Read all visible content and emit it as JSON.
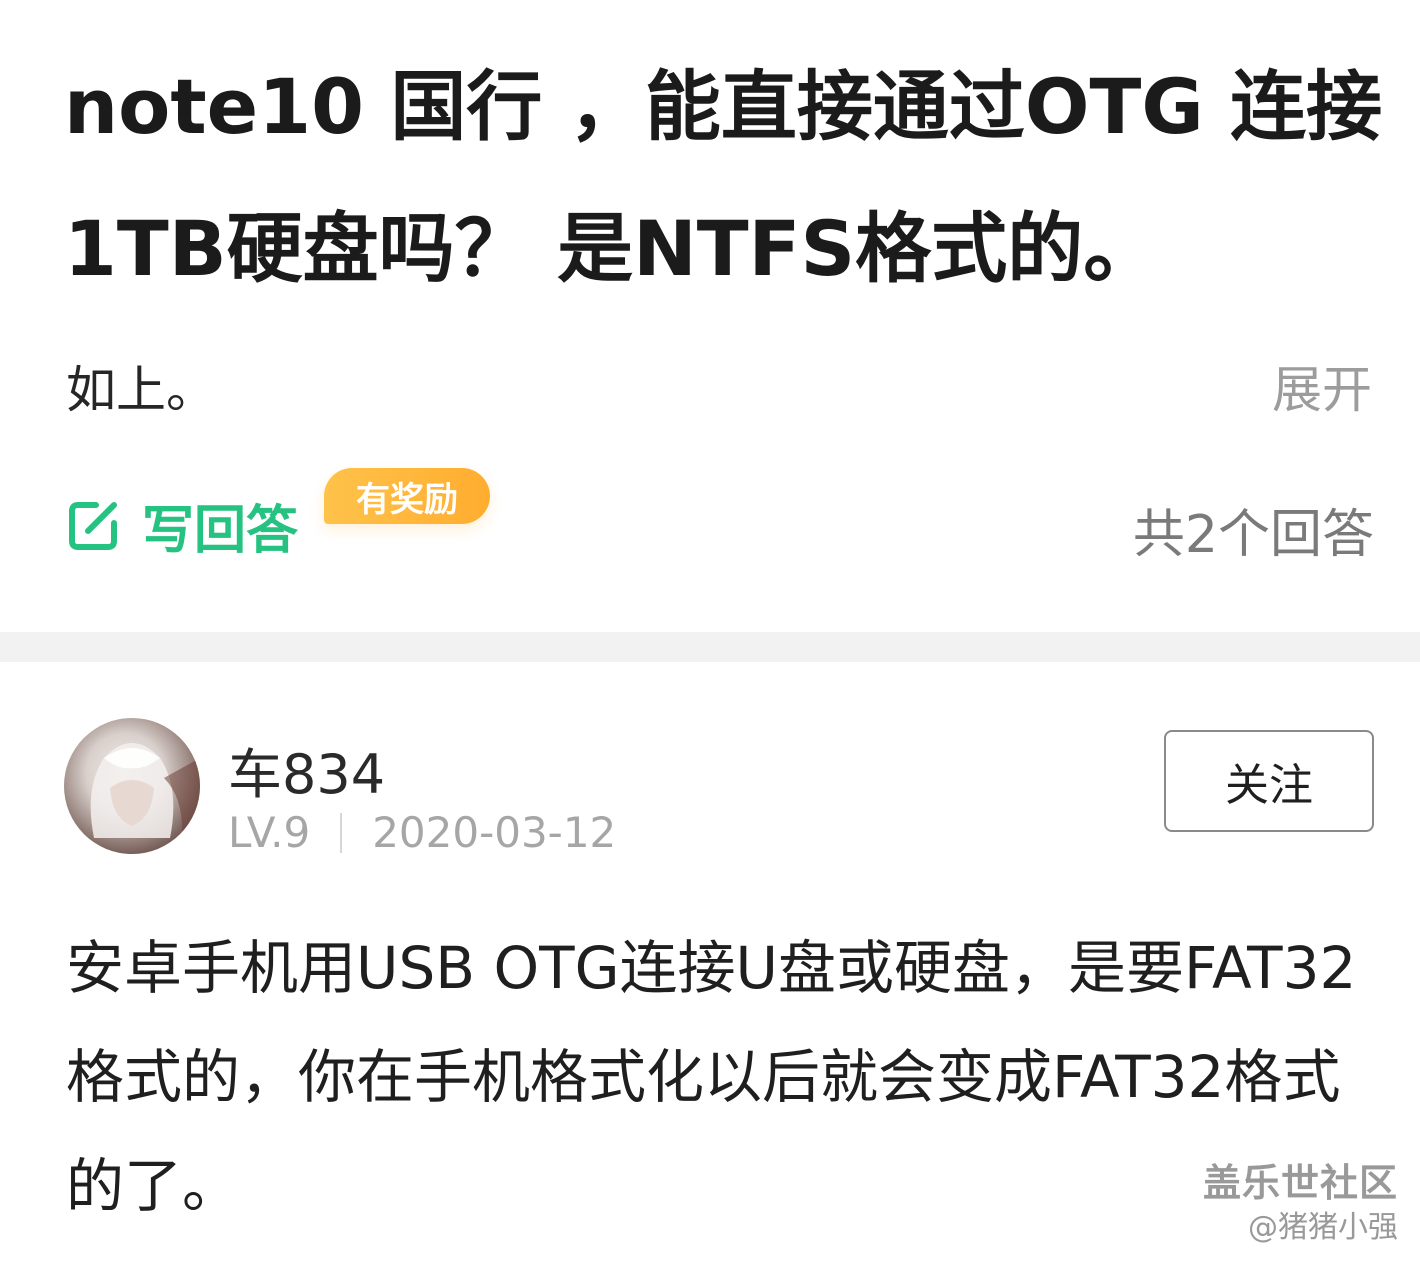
{
  "question": {
    "title": "note10 国行 ，能直接通过OTG 连接1TB硬盘吗？ 是NTFS格式的。",
    "body": "如上。",
    "expand_label": "展开"
  },
  "actions": {
    "write_answer_label": "写回答",
    "reward_badge": "有奖励",
    "answer_count": "共2个回答"
  },
  "answer": {
    "author": {
      "name": "车834",
      "level": "LV.9",
      "date": "2020-03-12"
    },
    "follow_label": "关注",
    "content": "安卓手机用USB OTG连接U盘或硬盘，是要FAT32格式的，你在手机格式化以后就会变成FAT32格式的了。"
  },
  "watermark": {
    "site": "盖乐世社区",
    "user": "@猪猪小强"
  },
  "colors": {
    "accent_green": "#26c281",
    "reward_orange": "#ffb436",
    "muted_gray": "#9c9c9c"
  },
  "icons": {
    "write_answer": "edit-icon"
  }
}
